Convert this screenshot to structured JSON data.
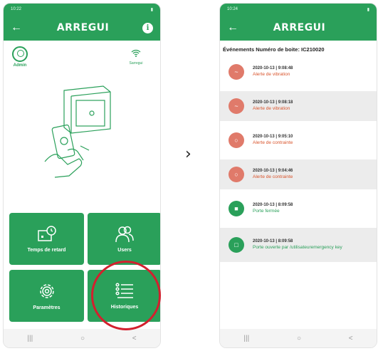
{
  "left_phone": {
    "status": {
      "time": "10:22",
      "battery": "▮"
    },
    "appbar": {
      "back": "←",
      "logo": "ARREGUI",
      "info": "i"
    },
    "admin_label": "Admin",
    "wifi_label": "Sarregui",
    "tiles": [
      {
        "label": "Temps de retard"
      },
      {
        "label": "Users"
      },
      {
        "label": "Paramètres"
      },
      {
        "label": "Historiques"
      }
    ],
    "nav": {
      "menu": "|||",
      "home": "○",
      "back": "<"
    }
  },
  "next_arrow": "›",
  "right_phone": {
    "status": {
      "time": "10:24",
      "battery": "▮"
    },
    "appbar": {
      "back": "←",
      "logo": "ARREGUI"
    },
    "title": "Événements Numéro de boite: IC210020",
    "events": [
      {
        "date": "2020-10-13 | 9:08:48",
        "desc": "Alerte de vibration",
        "type": "vibration"
      },
      {
        "date": "2020-10-13 | 9:08:18",
        "desc": "Alerte de vibration",
        "type": "vibration"
      },
      {
        "date": "2020-10-13 | 9:05:10",
        "desc": "Alerte de contrainte",
        "type": "constraint"
      },
      {
        "date": "2020-10-13 | 9:04:46",
        "desc": "Alerte de contrainte",
        "type": "constraint"
      },
      {
        "date": "2020-10-13 | 8:09:58",
        "desc": "Porte fermée",
        "type": "closed"
      },
      {
        "date": "2020-10-13 | 8:09:58",
        "desc": "Porte ouverte par /utilisateuremergency key",
        "type": "opened"
      }
    ],
    "nav": {
      "menu": "|||",
      "home": "○",
      "back": "<"
    }
  },
  "colors": {
    "brand_green": "#2aa05a",
    "alert_red": "#e07a6a",
    "alert_text": "#d9542c",
    "ok_text": "#2aa05a",
    "highlight_circle": "#d3202e"
  }
}
